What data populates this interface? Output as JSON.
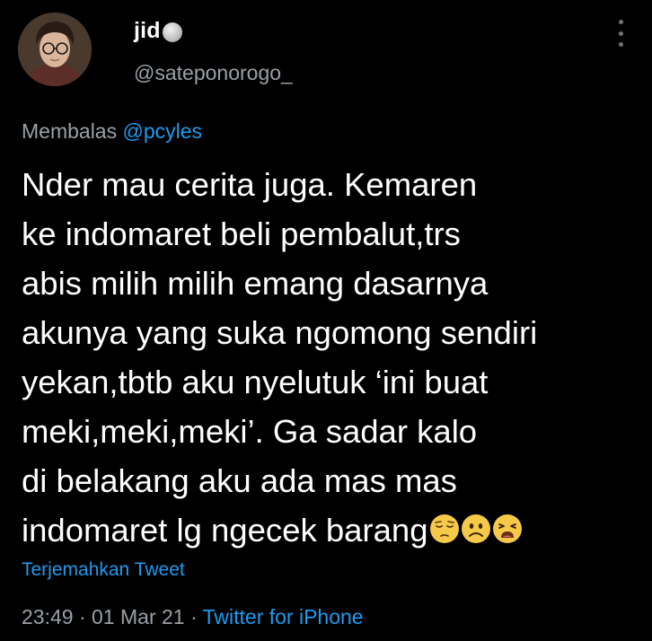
{
  "author": {
    "display_name": "jid",
    "handle": "@sateponorogo_",
    "avatar": "profile-photo-avatar",
    "status_icon": "gray-circle-emoji"
  },
  "reply": {
    "prefix": "Membalas",
    "mention": "@pcyles"
  },
  "tweet": {
    "text": "Nder mau cerita juga. Kemaren\nke indomaret beli pembalut,trs\nabis milih milih emang dasarnya\nakunya yang suka ngomong sendiri\nyekan,tbtb aku nyelutuk ‘ini buat\nmeki,meki,meki’. Ga sadar kalo\ndi belakang aku ada mas mas\nindomaret lg ngecek barang",
    "emojis": [
      "pensive-face-emoji",
      "frowning-face-emoji",
      "weary-face-emoji"
    ]
  },
  "translate_label": "Terjemahkan Tweet",
  "meta": {
    "time": "23:49",
    "separator": "·",
    "date": "01 Mar 21",
    "source": "Twitter for iPhone"
  },
  "colors": {
    "background": "#000000",
    "text": "#ffffff",
    "secondary": "#9aa0a6",
    "link": "#1d9bf0"
  }
}
